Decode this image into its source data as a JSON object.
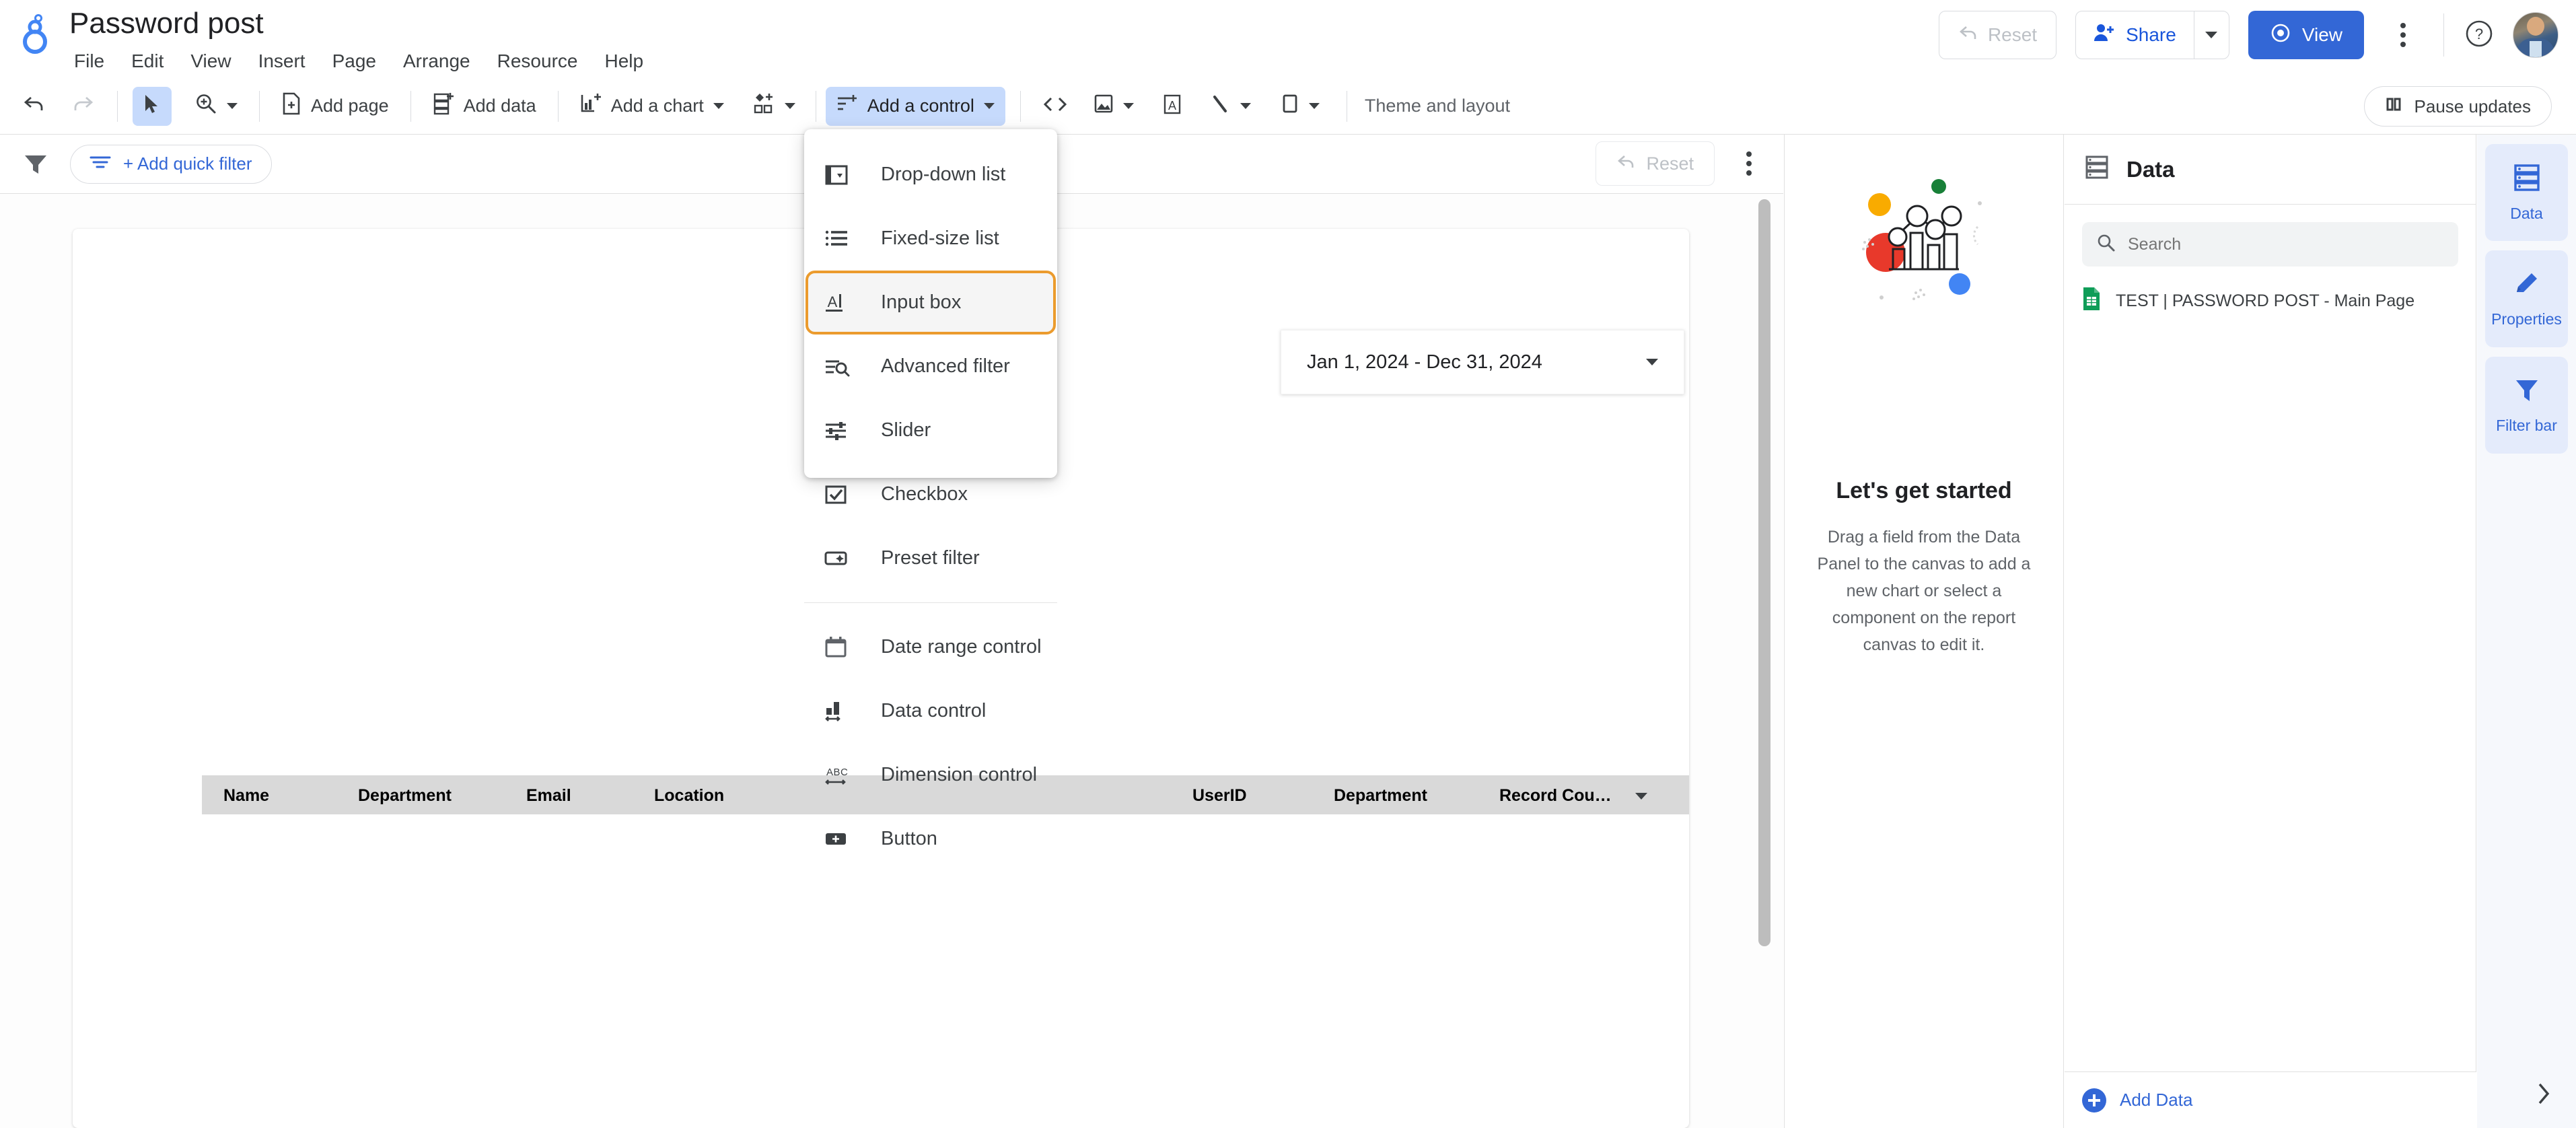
{
  "header": {
    "doc_title": "Password post",
    "logo_icon": "looker-studio-logo-icon",
    "menus": [
      "File",
      "Edit",
      "View",
      "Insert",
      "Page",
      "Arrange",
      "Resource",
      "Help"
    ],
    "reset_label": "Reset",
    "reset_icon": "undo-arrow-icon",
    "share_label": "Share",
    "share_icon": "person-add-icon",
    "share_caret_icon": "chevron-down-icon",
    "view_label": "View",
    "view_icon": "eye-icon",
    "more_icon": "kebab-menu-icon",
    "help_icon": "help-circle-icon",
    "avatar_icon": "user-avatar",
    "accent_blue": "#3367d6",
    "share_text_blue": "#1a56db"
  },
  "toolbar": {
    "undo_icon": "undo-icon",
    "redo_icon": "redo-icon",
    "select_icon": "cursor-arrow-icon",
    "zoom_icon": "zoom-in-icon",
    "zoom_caret_icon": "chevron-down-icon",
    "add_page_label": "Add page",
    "add_page_icon": "add-page-icon",
    "add_data_label": "Add data",
    "add_data_icon": "add-data-icon",
    "add_chart_label": "Add a chart",
    "add_chart_icon": "add-chart-icon",
    "add_chart_caret_icon": "chevron-down-icon",
    "community_viz_icon": "community-visualization-icon",
    "community_viz_caret_icon": "chevron-down-icon",
    "add_control_label": "Add a control",
    "add_control_icon": "add-control-icon",
    "add_control_caret_icon": "chevron-down-icon",
    "embed_icon": "embed-code-icon",
    "image_icon": "image-icon",
    "image_caret_icon": "chevron-down-icon",
    "text_icon": "text-box-icon",
    "line_icon": "line-tool-icon",
    "line_caret_icon": "chevron-down-icon",
    "shape_icon": "shape-tool-icon",
    "shape_caret_icon": "chevron-down-icon",
    "theme_label": "Theme and layout",
    "pause_label": "Pause updates",
    "pause_icon": "pause-icon"
  },
  "filter_bar": {
    "funnel_icon": "filter-funnel-icon",
    "add_quick_filter_label": "+ Add quick filter",
    "add_quick_filter_icon": "filter-lines-icon",
    "reset_label": "Reset",
    "reset_icon": "undo-arrow-icon",
    "kebab_icon": "kebab-menu-icon"
  },
  "add_control_menu": {
    "groups": [
      [
        {
          "label": "Drop-down list",
          "icon": "drop-down-list-icon",
          "highlighted": false
        },
        {
          "label": "Fixed-size list",
          "icon": "fixed-size-list-icon",
          "highlighted": false
        },
        {
          "label": "Input box",
          "icon": "input-box-icon",
          "highlighted": true
        },
        {
          "label": "Advanced filter",
          "icon": "advanced-filter-icon",
          "highlighted": false
        },
        {
          "label": "Slider",
          "icon": "slider-icon",
          "highlighted": false
        },
        {
          "label": "Checkbox",
          "icon": "checkbox-icon",
          "highlighted": false
        },
        {
          "label": "Preset filter",
          "icon": "preset-filter-icon",
          "highlighted": false
        }
      ],
      [
        {
          "label": "Date range control",
          "icon": "calendar-icon",
          "highlighted": false
        },
        {
          "label": "Data control",
          "icon": "data-control-icon",
          "highlighted": false
        },
        {
          "label": "Dimension control",
          "icon": "dimension-control-icon",
          "highlighted": false
        },
        {
          "label": "Button",
          "icon": "button-icon",
          "highlighted": false
        }
      ]
    ],
    "highlight_color": "#eb9b2d"
  },
  "canvas": {
    "date_range_value": "Jan 1, 2024 - Dec 31, 2024",
    "date_range_caret_icon": "chevron-down-icon",
    "table_headers_left": [
      "Name",
      "Department",
      "Email",
      "Location"
    ],
    "table_headers_right": [
      "UserID",
      "Department",
      "Record Cou…"
    ],
    "table_sort_icon": "sort-descending-icon"
  },
  "get_started": {
    "illustration_icon": "charts-illustration",
    "title": "Let's get started",
    "description": "Drag a field from the Data Panel to the canvas to add a new chart or select a component on the report canvas to edit it."
  },
  "data_panel": {
    "title": "Data",
    "title_icon": "database-icon",
    "search_placeholder": "Search",
    "search_value": "",
    "search_icon": "search-icon",
    "sources": [
      {
        "label": "TEST | PASSWORD POST - Main Page",
        "icon": "google-sheets-icon"
      }
    ],
    "add_data_label": "Add Data",
    "add_data_icon": "plus-circle-icon"
  },
  "rail": {
    "items": [
      {
        "label": "Data",
        "icon": "database-icon"
      },
      {
        "label": "Properties",
        "icon": "pencil-icon"
      },
      {
        "label": "Filter bar",
        "icon": "filter-funnel-icon"
      }
    ],
    "expand_icon": "chevron-right-icon"
  }
}
